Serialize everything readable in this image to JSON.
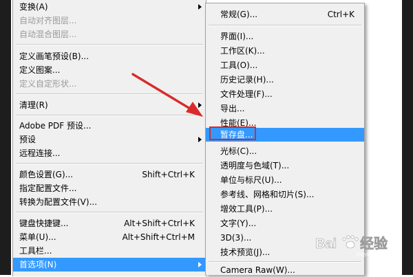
{
  "left_menu": {
    "items": [
      {
        "label": "变换(A)",
        "shortcut": "",
        "submenu": true,
        "disabled": false
      },
      {
        "label": "自动对齐图层...",
        "shortcut": "",
        "submenu": false,
        "disabled": true
      },
      {
        "label": "自动混合图层...",
        "shortcut": "",
        "submenu": false,
        "disabled": true
      },
      {
        "label": "定义画笔预设(B)...",
        "shortcut": "",
        "submenu": false,
        "disabled": false
      },
      {
        "label": "定义图案...",
        "shortcut": "",
        "submenu": false,
        "disabled": false
      },
      {
        "label": "定义自定形状...",
        "shortcut": "",
        "submenu": false,
        "disabled": true
      },
      {
        "label": "清理(R)",
        "shortcut": "",
        "submenu": true,
        "disabled": false
      },
      {
        "label": "Adobe PDF 预设...",
        "shortcut": "",
        "submenu": false,
        "disabled": false
      },
      {
        "label": "预设",
        "shortcut": "",
        "submenu": true,
        "disabled": false
      },
      {
        "label": "远程连接...",
        "shortcut": "",
        "submenu": false,
        "disabled": false
      },
      {
        "label": "颜色设置(G)...",
        "shortcut": "Shift+Ctrl+K",
        "submenu": false,
        "disabled": false
      },
      {
        "label": "指定配置文件...",
        "shortcut": "",
        "submenu": false,
        "disabled": false
      },
      {
        "label": "转换为配置文件(V)...",
        "shortcut": "",
        "submenu": false,
        "disabled": false
      },
      {
        "label": "键盘快捷键...",
        "shortcut": "Alt+Shift+Ctrl+K",
        "submenu": false,
        "disabled": false
      },
      {
        "label": "菜单(U)...",
        "shortcut": "Alt+Shift+Ctrl+M",
        "submenu": false,
        "disabled": false
      },
      {
        "label": "工具栏...",
        "shortcut": "",
        "submenu": false,
        "disabled": false
      },
      {
        "label": "首选项(N)",
        "shortcut": "",
        "submenu": true,
        "disabled": false,
        "selected": true
      }
    ]
  },
  "submenu": {
    "items": [
      {
        "label": "常规(G)...",
        "shortcut": "Ctrl+K"
      },
      {
        "label": "界面(I)...",
        "shortcut": ""
      },
      {
        "label": "工作区(K)...",
        "shortcut": ""
      },
      {
        "label": "工具(O)...",
        "shortcut": ""
      },
      {
        "label": "历史记录(H)...",
        "shortcut": ""
      },
      {
        "label": "文件处理(F)...",
        "shortcut": ""
      },
      {
        "label": "导出...",
        "shortcut": ""
      },
      {
        "label": "性能(E)...",
        "shortcut": ""
      },
      {
        "label": "暂存盘...",
        "shortcut": "",
        "selected": true
      },
      {
        "label": "光标(C)...",
        "shortcut": ""
      },
      {
        "label": "透明度与色域(T)...",
        "shortcut": ""
      },
      {
        "label": "单位与标尺(U)...",
        "shortcut": ""
      },
      {
        "label": "参考线、网格和切片(S)...",
        "shortcut": ""
      },
      {
        "label": "增效工具(P)...",
        "shortcut": ""
      },
      {
        "label": "文字(Y)...",
        "shortcut": ""
      },
      {
        "label": "3D(3)...",
        "shortcut": ""
      },
      {
        "label": "技术预览(J)...",
        "shortcut": ""
      },
      {
        "label": "Camera Raw(W)...",
        "shortcut": ""
      }
    ]
  },
  "watermark": {
    "text": "Baidu 经验",
    "url": "jingyan.baidu.com"
  },
  "colors": {
    "selection": "#3399ff",
    "highlight_box": "#d22b2b",
    "arrow": "#d92b2b"
  }
}
